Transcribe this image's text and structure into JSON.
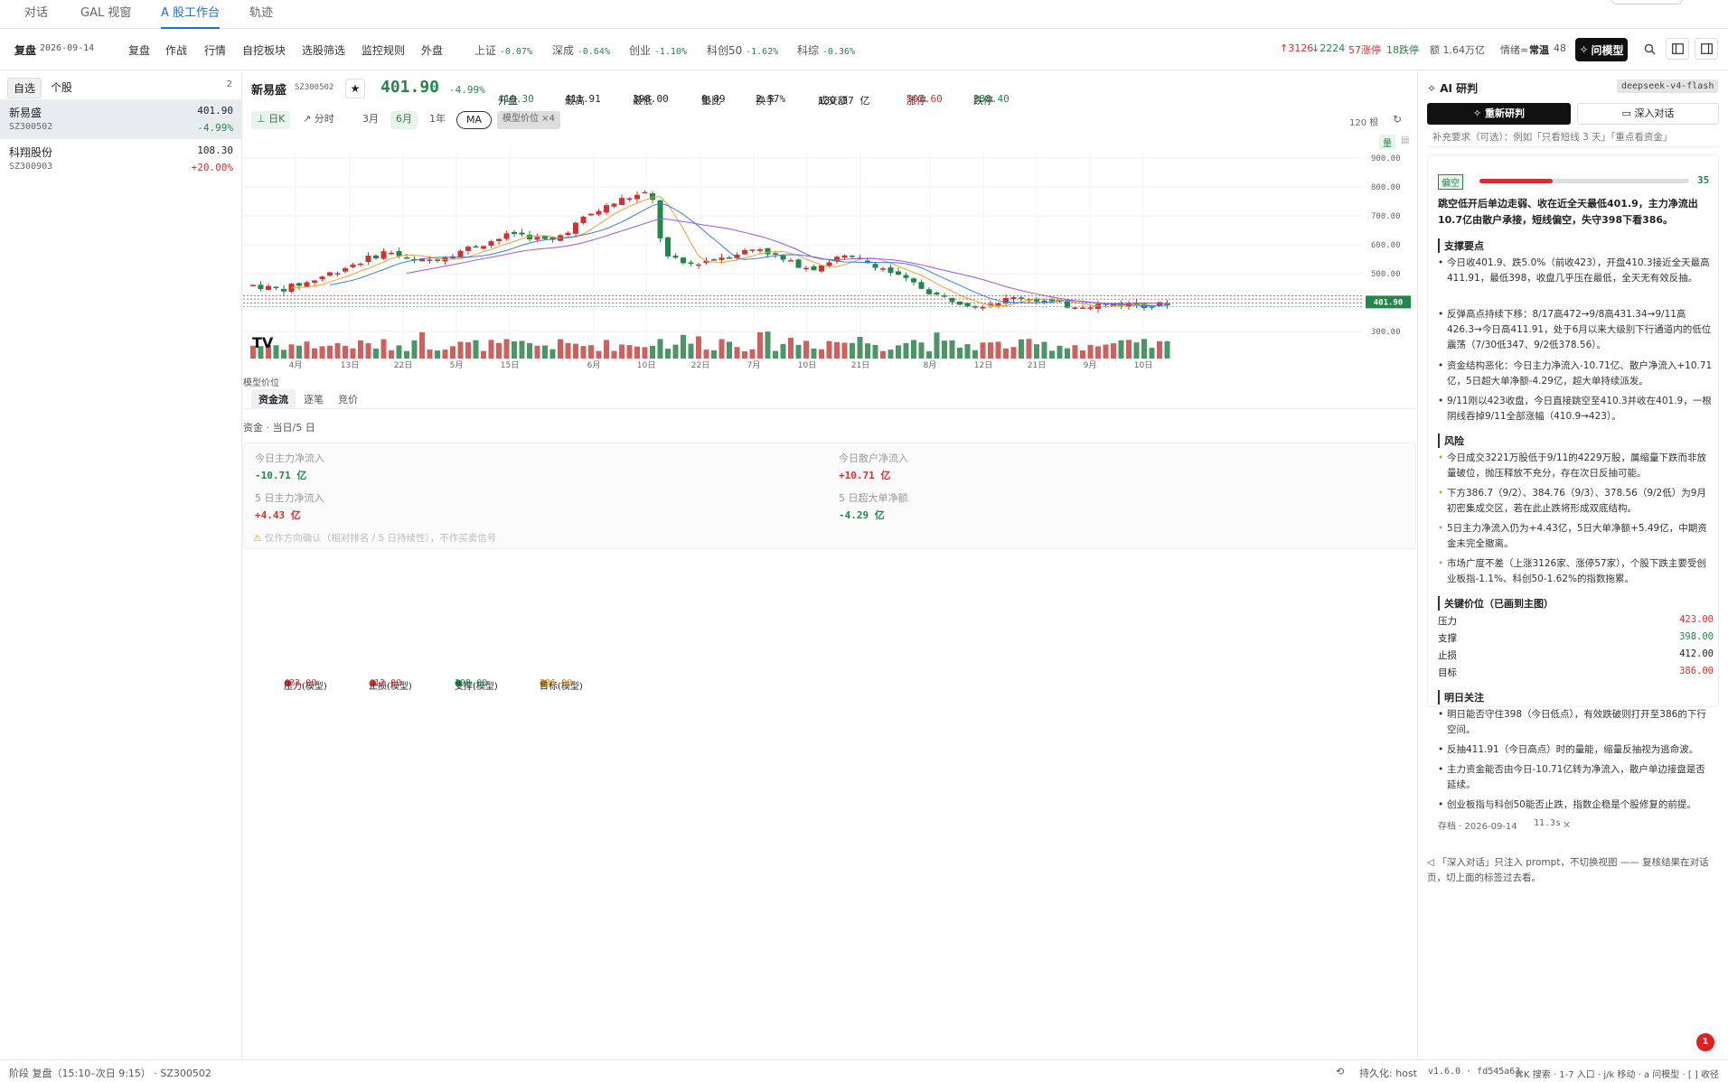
{
  "tabs": [
    {
      "label": "对话"
    },
    {
      "label": "GAL 视窗"
    },
    {
      "label": "A 股工作台"
    },
    {
      "label": "轨迹"
    }
  ],
  "toolbar": {
    "mode": "复盘",
    "date": "2026-09-14",
    "nav": [
      "复盘",
      "作战",
      "行情",
      "自挖板块",
      "选股筛选",
      "监控规则",
      "外盘"
    ],
    "indices": [
      {
        "name": "上证",
        "chg": "-0.07%"
      },
      {
        "name": "深成",
        "chg": "-0.64%"
      },
      {
        "name": "创业",
        "chg": "-1.10%"
      },
      {
        "name": "科创50",
        "chg": "-1.62%"
      },
      {
        "name": "科综",
        "chg": "-0.36%"
      }
    ],
    "breadth_up": "↑3126",
    "breadth_down": "↓2224",
    "limit_up": "57涨停",
    "limit_down": "18跌停",
    "amount": "额 1.64万亿",
    "sentiment_label": "情绪≈",
    "sentiment_value": "常温",
    "sentiment_num": "48",
    "ask_label": "问模型"
  },
  "left": {
    "tab_watch": "自选",
    "tab_single": "个股",
    "count": "2",
    "stocks": [
      {
        "name": "新易盛",
        "code": "SZ300502",
        "price": "401.90",
        "chg": "-4.99%"
      },
      {
        "name": "科翔股份",
        "code": "SZ300903",
        "price": "108.30",
        "chg": "+20.00%"
      }
    ]
  },
  "quote": {
    "name": "新易盛",
    "code": "SZ300502",
    "price": "401.90",
    "chg": "-4.99%",
    "open_l": "开盘",
    "open": "410.30",
    "high_l": "最高",
    "high": "411.91",
    "low_l": "最低",
    "low": "398.00",
    "vr_l": "量比",
    "vr": "0.89",
    "to_l": "换手",
    "to": "2.57%",
    "amt_l": "成交额",
    "amt": "130.37 亿",
    "lu_l": "涨停",
    "lu": "507.60",
    "ld_l": "跌停",
    "ld": "338.40"
  },
  "chart_ctrl": {
    "daily": "日K",
    "minute": "分时",
    "r3": "3月",
    "r6": "6月",
    "r1y": "1年",
    "ma": "MA",
    "model": "模型价位 ×4",
    "bars": "120 根",
    "vol": "量"
  },
  "chart_data": {
    "type": "candlestick",
    "y_ticks": [
      "900.00",
      "800.00",
      "700.00",
      "600.00",
      "500.00",
      "400.00",
      "300.00"
    ],
    "ylim": [
      300,
      900
    ],
    "x_ticks": [
      "4月",
      "13日",
      "22日",
      "5月",
      "15日",
      "6月",
      "10日",
      "22日",
      "7月",
      "10日",
      "21日",
      "8月",
      "12日",
      "21日",
      "9月",
      "10日"
    ],
    "last_label": "401.90",
    "levels": [
      {
        "name": "压力(模型)",
        "value": "423.00",
        "color": "#d0332f"
      },
      {
        "name": "止损(模型)",
        "value": "412.00",
        "color": "#d0332f"
      },
      {
        "name": "支撑(模型)",
        "value": "398.00",
        "color": "#23864a"
      },
      {
        "name": "目标(模型)",
        "value": "386.00",
        "color": "#c8861a"
      }
    ],
    "legend_prefix": "模型价位"
  },
  "fund": {
    "tab1": "资金流",
    "tab2": "逐笔",
    "tab3": "竞价",
    "title": "资金 · 当日/5 日",
    "c1_l": "今日主力净流入",
    "c1_v": "-10.71 亿",
    "c2_l": "今日散户净流入",
    "c2_v": "+10.71 亿",
    "c3_l": "5 日主力净流入",
    "c3_v": "+4.43 亿",
    "c4_l": "5 日超大单净额",
    "c4_v": "-4.29 亿",
    "warn": "仅作方向确认（相对排名 / 5 日持续性），不作买卖信号"
  },
  "ai": {
    "title": "AI 研判",
    "model": "deepseek-v4-flash",
    "rerun": "重新研判",
    "deep": "深入对话",
    "hint": "补充要求（可选）：例如「只看短线 3 天」「重点看资金」",
    "stance": "偏空",
    "score": "35",
    "score_frac": 0.35,
    "summary": "跳空低开后单边走弱、收在近全天最低401.9，主力净流出10.7亿由散户承接，短线偏空，失守398下看386。",
    "s1": "支撑要点",
    "b1": [
      "今日收401.9、跌5.0%（前收423），开盘410.3接近全天最高411.91，最低398，收盘几乎压在最低，全天无有效反抽。",
      "反弹高点持续下移：8/17高472→9/8高431.34→9/11高426.3→今日高411.91，处于6月以来大级别下行通道内的低位震荡（7/30低347、9/2低378.56）。",
      "资金结构恶化：今日主力净流入-10.71亿、散户净流入+10.71亿，5日超大单净额-4.29亿，超大单持续派发。",
      "9/11刚以423收盘，今日直接跳空至410.3并收在401.9，一根阴线吞掉9/11全部涨幅（410.9→423）。"
    ],
    "s2": "风险",
    "b2": [
      "今日成交3221万股低于9/11的4229万股，属缩量下跌而非放量破位，抛压释放不充分，存在次日反抽可能。",
      "下方386.7（9/2）、384.76（9/3）、378.56（9/2低）为9月初密集成交区，若在此止跌将形成双底结构。",
      "5日主力净流入仍为+4.43亿，5日大单净额+5.49亿，中期资金未完全撤离。",
      "市场广度不差（上涨3126家、涨停57家），个股下跌主要受创业板指-1.1%、科创50-1.62%的指数拖累。"
    ],
    "s3": "关键价位（已画到主图）",
    "levels": [
      {
        "k": "压力",
        "v": "423.00"
      },
      {
        "k": "支撑",
        "v": "398.00"
      },
      {
        "k": "止损",
        "v": "412.00"
      },
      {
        "k": "目标",
        "v": "386.00"
      }
    ],
    "s4": "明日关注",
    "b4": [
      "明日能否守住398（今日低点），有效跌破则打开至386的下行空间。",
      "反抽411.91（今日高点）时的量能，缩量反抽视为逃命波。",
      "主力资金能否由今日-10.71亿转为净流入，散户单边接盘是否延续。",
      "创业板指与科创50能否止跌，指数企稳是个股修复的前提。"
    ],
    "archive": "存档 · 2026-09-14",
    "elapsed": "11.3s",
    "note": "「深入对话」只注入 prompt，不切换视图 —— 复核结果在对话页，切上面的标签过去看。"
  },
  "status": {
    "left": "阶段 复盘（15:10–次日 9:15） · SZ300502",
    "persist": "持久化: host",
    "version": "v1.6.0 · fd545a63",
    "keys": "⌘K 搜索 · 1-7 入口 · j/k 移动 · a 问模型 · [ ] 收径",
    "badge": "1"
  }
}
